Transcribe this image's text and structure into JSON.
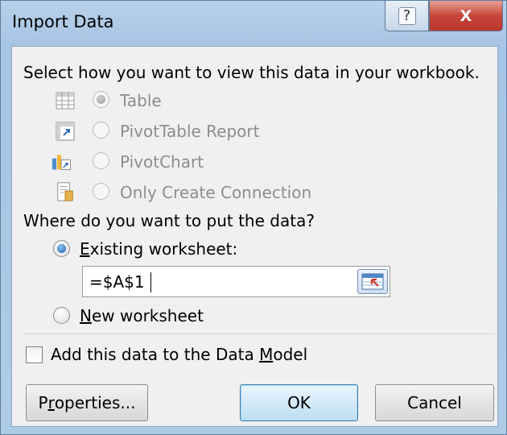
{
  "window": {
    "title": "Import Data",
    "help_label": "?",
    "close_label": "X"
  },
  "view_section": {
    "prompt": "Select how you want to view this data in your workbook.",
    "options": [
      {
        "label": "Table",
        "icon": "table-icon",
        "selected": true,
        "enabled": false
      },
      {
        "label": "PivotTable Report",
        "icon": "pivottable-icon",
        "selected": false,
        "enabled": false
      },
      {
        "label": "PivotChart",
        "icon": "pivotchart-icon",
        "selected": false,
        "enabled": false
      },
      {
        "label": "Only Create Connection",
        "icon": "connection-icon",
        "selected": false,
        "enabled": false
      }
    ]
  },
  "location_section": {
    "prompt": "Where do you want to put the data?",
    "existing_label_pre": "",
    "existing_label_underline": "E",
    "existing_label_post": "xisting worksheet:",
    "existing_selected": true,
    "reference_value": "=$A$1",
    "new_label_pre": "",
    "new_label_underline": "N",
    "new_label_post": "ew worksheet",
    "new_selected": false
  },
  "data_model": {
    "label_pre": "Add this data to the Data ",
    "label_underline": "M",
    "label_post": "odel",
    "checked": false
  },
  "buttons": {
    "properties_pre": "P",
    "properties_underline": "r",
    "properties_post": "operties...",
    "ok": "OK",
    "cancel": "Cancel"
  },
  "colors": {
    "title_bar": "#b9d1ea",
    "close_button": "#c7453a",
    "client_background": "#f0f0f0",
    "default_button": "#d4eaf9"
  }
}
